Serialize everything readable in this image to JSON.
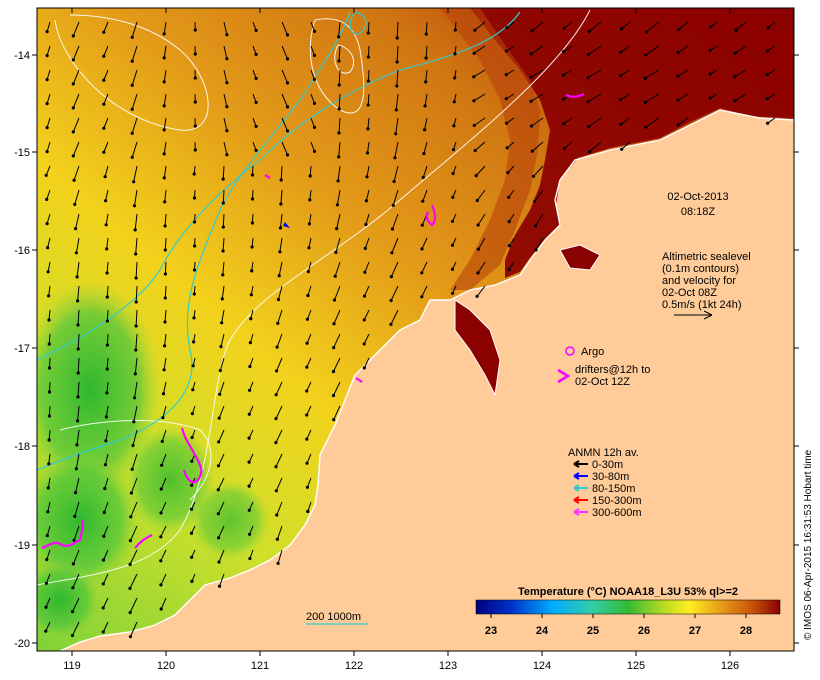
{
  "map": {
    "date_label": "02-Oct-2013",
    "time_label": "08:18Z",
    "x_ticks": [
      "119",
      "120",
      "121",
      "122",
      "123",
      "124",
      "125",
      "126"
    ],
    "y_ticks": [
      "-14",
      "-15",
      "-16",
      "-17",
      "-18",
      "-19",
      "-20"
    ]
  },
  "legend": {
    "altimetry_lines": [
      "Altimetric sealevel",
      "(0.1m contours)",
      "and velocity for",
      "02-Oct 08Z",
      "0.5m/s (1kt 24h)"
    ],
    "argo_label": "Argo",
    "drifter_lines": [
      "drifters@12h to",
      "02-Oct 12Z"
    ],
    "anmn_title": "ANMN 12h av.",
    "anmn_items": [
      {
        "label": "0-30m",
        "color": "#000000"
      },
      {
        "label": "30-80m",
        "color": "#0000ff"
      },
      {
        "label": "80-150m",
        "color": "#33cccc"
      },
      {
        "label": "150-300m",
        "color": "#ff0000"
      },
      {
        "label": "300-600m",
        "color": "#ff33ff"
      }
    ],
    "bathy_label": "200  1000m"
  },
  "colorbar": {
    "title": "Temperature (°C) NOAA18_L3U 53% ql>=2",
    "ticks": [
      "23",
      "24",
      "25",
      "26",
      "27",
      "28"
    ]
  },
  "credit": "© IMOS 06-Apr-2015 16:31:53 Hobart time",
  "colors": {
    "land": "#ffcc99",
    "argo": "#ff00ff",
    "isobath": "#33cccc",
    "sealevel_contour": "#ffffff"
  }
}
